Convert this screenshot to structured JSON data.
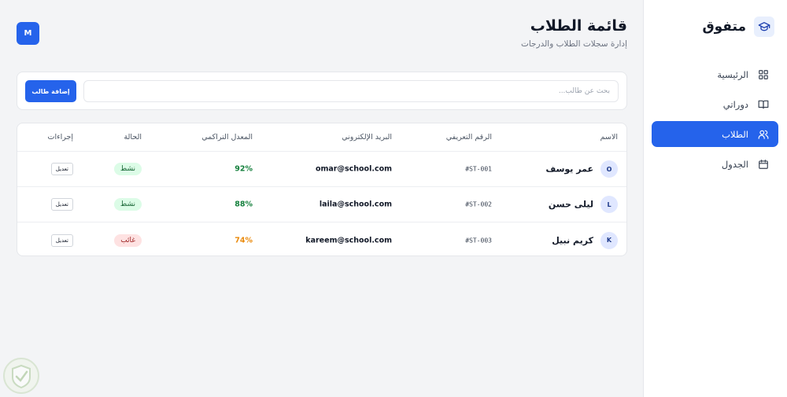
{
  "app": {
    "name": "متفوق"
  },
  "sidebar": {
    "items": [
      {
        "label": "الرئيسية",
        "icon": "grid-icon",
        "active": false
      },
      {
        "label": "دوراتي",
        "icon": "book-icon",
        "active": false
      },
      {
        "label": "الطلاب",
        "icon": "users-icon",
        "active": true
      },
      {
        "label": "الجدول",
        "icon": "calendar-icon",
        "active": false
      }
    ]
  },
  "header": {
    "title": "قائمة الطلاب",
    "subtitle": "إدارة سجلات الطلاب والدرجات",
    "avatar": "M"
  },
  "toolbar": {
    "search_placeholder": "بحث عن طالب...",
    "add_label": "إضافة طالب"
  },
  "table": {
    "columns": {
      "name": "الاسم",
      "id": "الرقم التعريفي",
      "email": "البريد الإلكتروني",
      "gpa": "المعدل التراكمي",
      "status": "الحالة",
      "actions": "إجراءات"
    },
    "rows": [
      {
        "initial": "O",
        "name": "عمر يوسف",
        "id": "#ST-001",
        "email": "omar@school.com",
        "gpa": "92%",
        "gpa_color": "#15803d",
        "status": "نشط",
        "status_type": "active",
        "action": "تعديل"
      },
      {
        "initial": "L",
        "name": "ليلى حسن",
        "id": "#ST-002",
        "email": "laila@school.com",
        "gpa": "88%",
        "gpa_color": "#15803d",
        "status": "نشط",
        "status_type": "active",
        "action": "تعديل"
      },
      {
        "initial": "K",
        "name": "كريم نبيل",
        "id": "#ST-003",
        "email": "kareem@school.com",
        "gpa": "74%",
        "gpa_color": "#ea8a0c",
        "status": "غائب",
        "status_type": "absent",
        "action": "تعديل"
      }
    ]
  },
  "colors": {
    "accent": "#2563eb",
    "active_badge_bg": "#dcfce7",
    "active_badge_text": "#166534",
    "absent_badge_bg": "#fee2e2",
    "absent_badge_text": "#991b1b"
  }
}
